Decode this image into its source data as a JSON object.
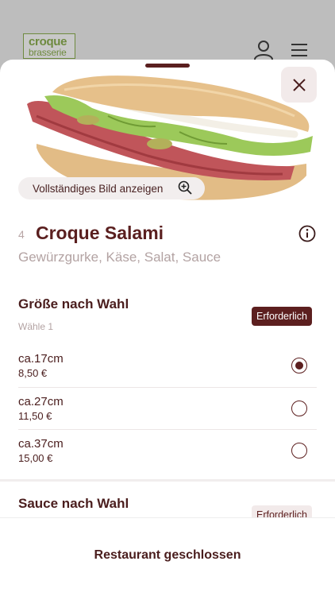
{
  "header": {
    "logo_line1": "croque",
    "logo_line2": "brasserie"
  },
  "product": {
    "number": "4",
    "title": "Croque Salami",
    "ingredients": "Gewürzgurke, Käse, Salat, Sauce",
    "full_image_label": "Vollständiges Bild anzeigen"
  },
  "sections": [
    {
      "title": "Größe nach Wahl",
      "hint": "Wähle 1",
      "badge": "Erforderlich",
      "options": [
        {
          "size": "ca.17cm",
          "price": "8,50 €",
          "selected": true
        },
        {
          "size": "ca.27cm",
          "price": "11,50 €",
          "selected": false
        },
        {
          "size": "ca.37cm",
          "price": "15,00 €",
          "selected": false
        }
      ]
    },
    {
      "title": "Sauce nach Wahl",
      "badge": "Erforderlich"
    }
  ],
  "footer": {
    "status": "Restaurant geschlossen"
  },
  "colors": {
    "brand": "#5c1f1f",
    "logo_green": "#6e8a3f"
  },
  "icons": {
    "close": "close-icon",
    "zoom": "zoom-in-icon",
    "info": "info-icon",
    "user": "user-icon",
    "menu": "menu-icon"
  }
}
